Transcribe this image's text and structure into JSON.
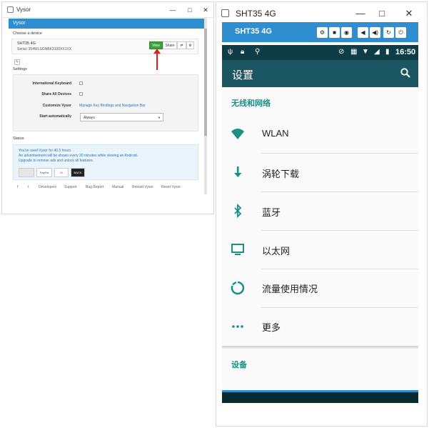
{
  "vysor": {
    "window_title": "Vysor",
    "app_title": "Vysor",
    "choose_device_label": "Choose a device",
    "device": {
      "name": "SHT35 4G",
      "serial": "Serial: 354WLSGNBK3100XX1XX"
    },
    "buttons": {
      "view": "View",
      "share": "Share",
      "wifi": "⇌",
      "gear": "⚙"
    },
    "settings_label": "Settings",
    "settings": {
      "international_keyboard": "International Keyboard",
      "share_all_devices": "Share All Devices",
      "customize_vysor": "Customize Vysor",
      "customize_link": "Manage Key Bindings and Navigation Bar",
      "start_automatically": "Start automatically",
      "start_value": "Always"
    },
    "status_label": "Status",
    "status_lines": [
      "You've used Vysor for 40.5 hours.",
      "An advertisement will be shown every 30 minutes while viewing an Android.",
      "Upgrade to remove ads and unlock all features."
    ],
    "pay_logos": [
      "",
      "PayPal",
      "W",
      "BACK"
    ],
    "footer": [
      "f",
      "t",
      "Developers",
      "Support",
      "Bug Report",
      "Manual",
      "Reload Vysor",
      "Reset Vysor"
    ],
    "window_controls": [
      "—",
      "□",
      "✕"
    ]
  },
  "android": {
    "window_title": "SHT35 4G",
    "toolbar_title": "SHT35 4G",
    "toolbar_buttons": [
      "⚙",
      "■",
      "◉",
      "◀",
      "◀)",
      "↻",
      "⏻"
    ],
    "window_controls": [
      "—",
      "□",
      "✕"
    ],
    "status_time": "16:50",
    "header_title": "设置",
    "section_wireless": "无线和网络",
    "items": [
      {
        "label": "WLAN",
        "icon": "wifi-icon"
      },
      {
        "label": "涡轮下载",
        "icon": "download-arrow-icon"
      },
      {
        "label": "蓝牙",
        "icon": "bluetooth-icon"
      },
      {
        "label": "以太网",
        "icon": "monitor-icon"
      },
      {
        "label": "流量使用情况",
        "icon": "data-usage-icon"
      },
      {
        "label": "更多",
        "icon": "more-dots-icon"
      }
    ],
    "section_device": "设备",
    "colors": {
      "teal": "#1a8f84",
      "header": "#1b5763",
      "toolbar": "#2f8ed0",
      "statusbar": "#0f3d47"
    }
  }
}
